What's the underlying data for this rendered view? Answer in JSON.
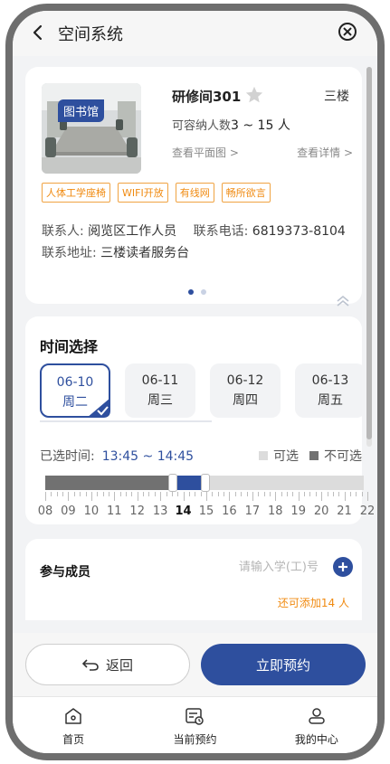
{
  "header": {
    "title": "空间系统"
  },
  "room": {
    "badge": "图书馆",
    "name": "研修间301",
    "floor": "三楼",
    "capacity_label": "可容纳人数",
    "capacity_value": "3 ~ 15 人",
    "floorplan_link": "查看平面图 >",
    "details_link": "查看详情 >",
    "tags": [
      "人体工学座椅",
      "WIFI开放",
      "有线网",
      "畅所欲言"
    ],
    "contact_person_label": "联系人:",
    "contact_person": "阅览区工作人员",
    "contact_phone_label": "联系电话:",
    "contact_phone": "6819373-8104",
    "contact_address_label": "联系地址:",
    "contact_address": "三楼读者服务台",
    "carousel_pages": 2,
    "carousel_active": 0
  },
  "time": {
    "title": "时间选择",
    "dates": [
      {
        "date": "06-10",
        "weekday": "周二",
        "selected": true
      },
      {
        "date": "06-11",
        "weekday": "周三",
        "selected": false
      },
      {
        "date": "06-12",
        "weekday": "周四",
        "selected": false
      },
      {
        "date": "06-13",
        "weekday": "周五",
        "selected": false
      }
    ],
    "selected_label": "已选时间:",
    "selected_value": "13:45 ~ 14:45",
    "legend_available": "可选",
    "legend_unavailable": "不可选",
    "hours": [
      "08",
      "09",
      "10",
      "11",
      "12",
      "13",
      "14",
      "15",
      "16",
      "17",
      "18",
      "19",
      "20",
      "21",
      "22"
    ],
    "current_hour": "14",
    "booked_until_hour": 13.5,
    "selection_start_hour": 13.75,
    "selection_end_hour": 14.75
  },
  "members": {
    "title": "参与成员",
    "input_placeholder": "请输入学(工)号",
    "input_value": "",
    "remaining": "还可添加14 人"
  },
  "actions": {
    "back_label": "返回",
    "book_label": "立即预约"
  },
  "tabs": [
    {
      "label": "首页",
      "icon": "home-icon"
    },
    {
      "label": "当前预约",
      "icon": "booking-icon"
    },
    {
      "label": "我的中心",
      "icon": "profile-icon"
    }
  ],
  "colors": {
    "primary": "#2e4f9e",
    "tag_orange": "#f08a10",
    "unavailable": "#717171",
    "available": "#dcdcdc"
  }
}
